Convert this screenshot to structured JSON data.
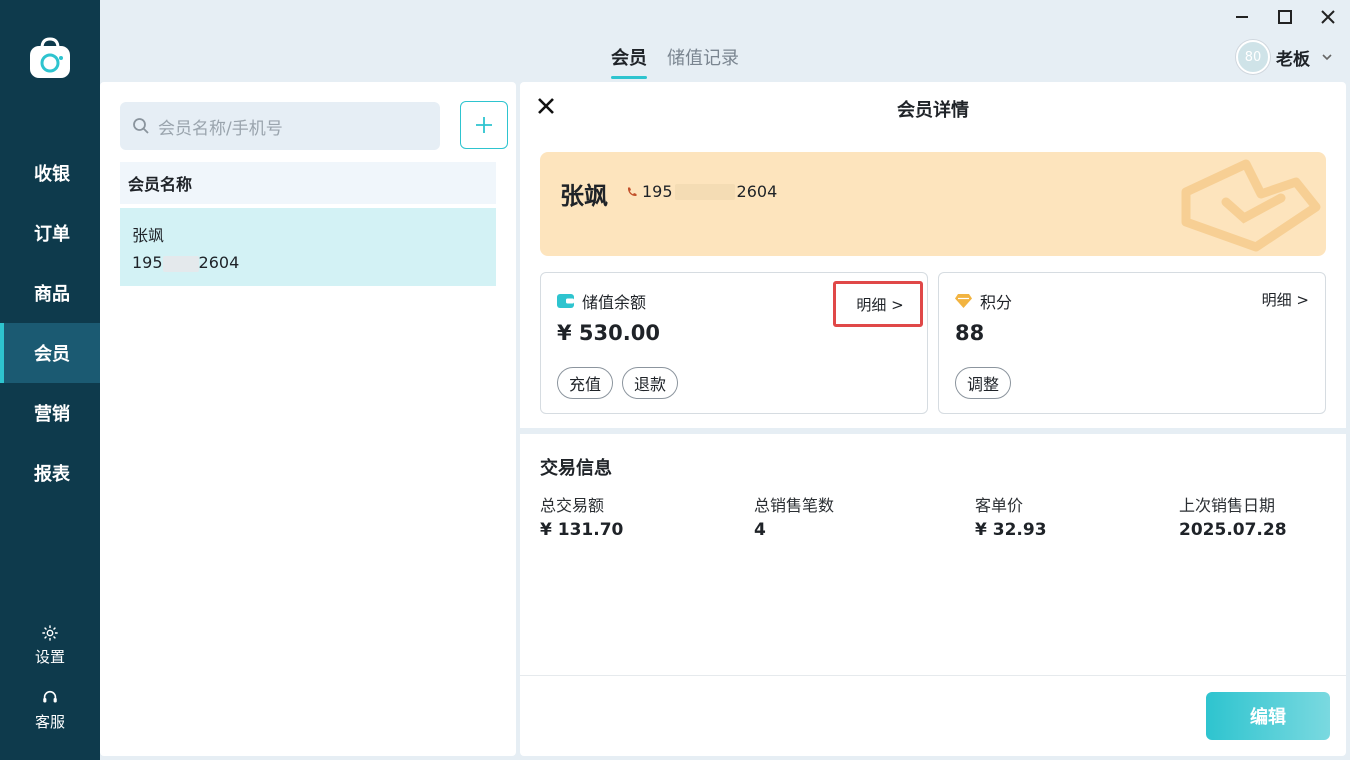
{
  "app": {
    "logo_icon": "shopping-bag-logo-icon"
  },
  "sidebar": {
    "items": [
      {
        "label": "收银"
      },
      {
        "label": "订单"
      },
      {
        "label": "商品"
      },
      {
        "label": "会员",
        "active": true
      },
      {
        "label": "营销"
      },
      {
        "label": "报表"
      }
    ],
    "settings_label": "设置",
    "support_label": "客服"
  },
  "header": {
    "tabs": [
      {
        "label": "会员",
        "active": true
      },
      {
        "label": "储值记录",
        "active": false
      }
    ],
    "user": {
      "avatar_text": "80",
      "name": "老板"
    }
  },
  "member_list": {
    "search_placeholder": "会员名称/手机号",
    "column_header": "会员名称",
    "rows": [
      {
        "name": "张飒",
        "phone_prefix": "195",
        "phone_suffix": "2604"
      }
    ]
  },
  "detail": {
    "title": "会员详情",
    "member": {
      "name": "张飒",
      "phone_prefix": "195",
      "phone_suffix": "2604"
    },
    "balance": {
      "label": "储值余额",
      "link": "明细 >",
      "value": "¥ 530.00",
      "buttons": [
        "充值",
        "退款"
      ]
    },
    "points": {
      "label": "积分",
      "link": "明细 >",
      "value": "88",
      "buttons": [
        "调整"
      ]
    },
    "trade": {
      "title": "交易信息",
      "stats": [
        {
          "label": "总交易额",
          "value": "¥ 131.70"
        },
        {
          "label": "总销售笔数",
          "value": "4"
        },
        {
          "label": "客单价",
          "value": "¥ 32.93"
        },
        {
          "label": "上次销售日期",
          "value": "2025.07.28"
        }
      ]
    },
    "edit_label": "编辑"
  },
  "colors": {
    "sidebar": "#0e3a4c",
    "accent": "#2ec4cf",
    "card": "#fde4bd",
    "highlight": "#e04848"
  }
}
